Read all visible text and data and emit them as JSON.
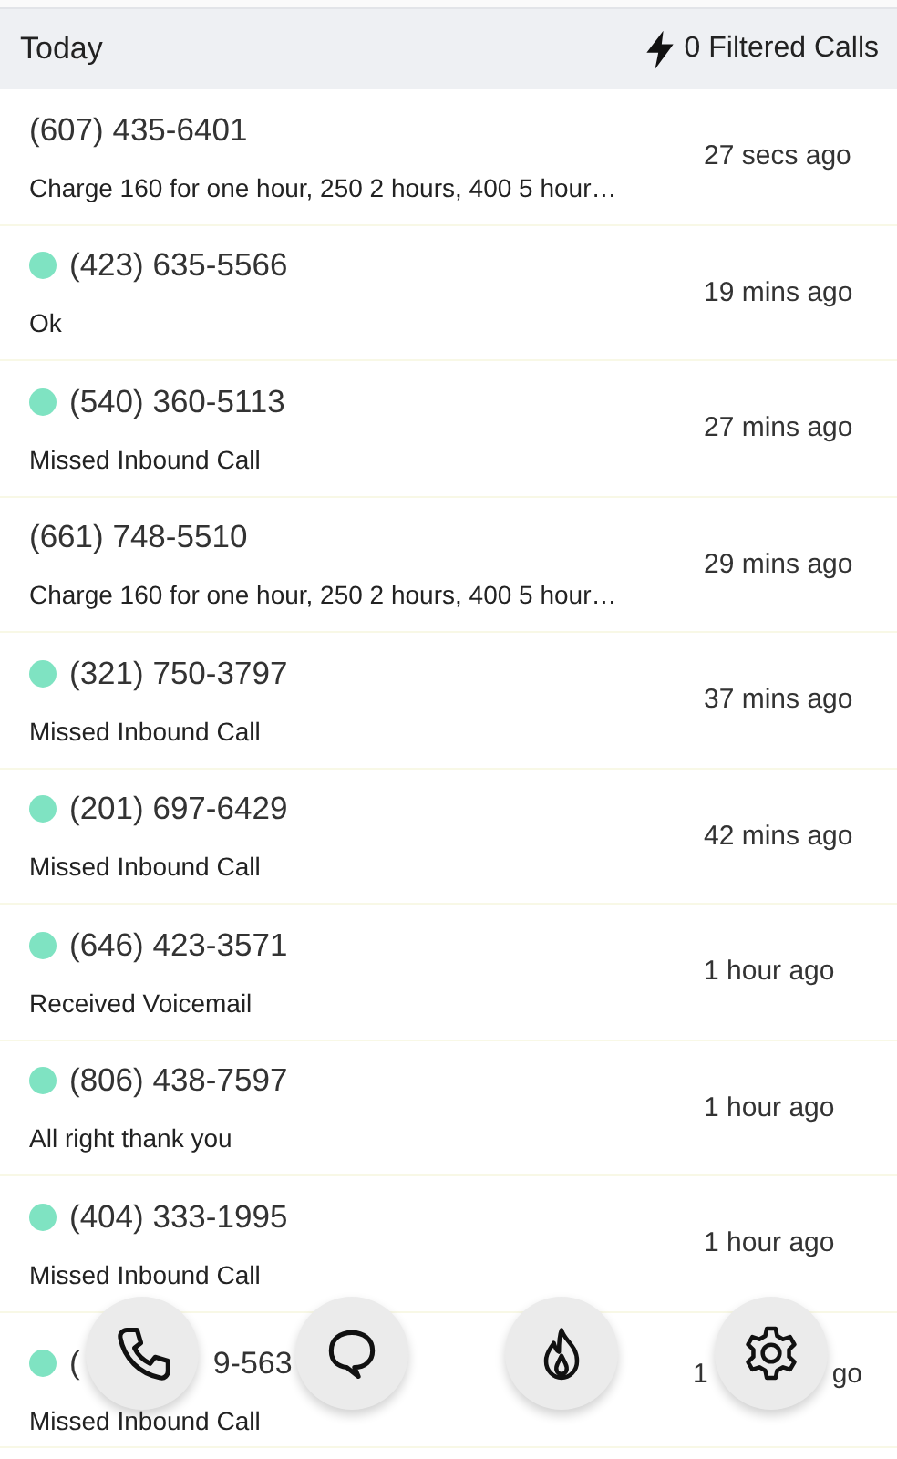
{
  "header": {
    "title": "Today",
    "filtered": "0 Filtered Calls"
  },
  "calls": [
    {
      "kind": "full",
      "marked": false,
      "phone": "(607) 435-6401",
      "message": "Charge 160 for one hour, 250 2 hours, 400 5 hour…",
      "time": "27 secs ago"
    },
    {
      "kind": "full",
      "marked": true,
      "phone": "(423) 635-5566",
      "message": "Ok",
      "time": "19 mins ago"
    },
    {
      "kind": "full",
      "marked": true,
      "phone": "(540) 360-5113",
      "message": "Missed Inbound Call",
      "time": "27 mins ago"
    },
    {
      "kind": "full",
      "marked": false,
      "phone": "(661) 748-5510",
      "message": "Charge 160 for one hour, 250 2 hours, 400 5 hour…",
      "time": "29 mins ago"
    },
    {
      "kind": "full",
      "marked": true,
      "phone": "(321) 750-3797",
      "message": "Missed Inbound Call",
      "time": "37 mins ago"
    },
    {
      "kind": "full",
      "marked": true,
      "phone": "(201) 697-6429",
      "message": "Missed Inbound Call",
      "time": "42 mins ago"
    },
    {
      "kind": "full",
      "marked": true,
      "phone": "(646) 423-3571",
      "message": "Received Voicemail",
      "time": "1 hour ago"
    },
    {
      "kind": "full",
      "marked": true,
      "phone": "(806) 438-7597",
      "message": "All right thank you",
      "time": "1 hour ago"
    },
    {
      "kind": "full",
      "marked": true,
      "phone": "(404) 333-1995",
      "message": "Missed Inbound Call",
      "time": "1 hour ago"
    },
    {
      "kind": "covered",
      "marked": true,
      "phone_parts": [
        "(",
        "9-563"
      ],
      "message": "Missed Inbound Call",
      "time_parts": [
        "1",
        "go"
      ]
    }
  ],
  "actions": [
    {
      "kind": "phone"
    },
    {
      "kind": "chat"
    },
    {
      "kind": "fire"
    },
    {
      "kind": "settings"
    }
  ]
}
